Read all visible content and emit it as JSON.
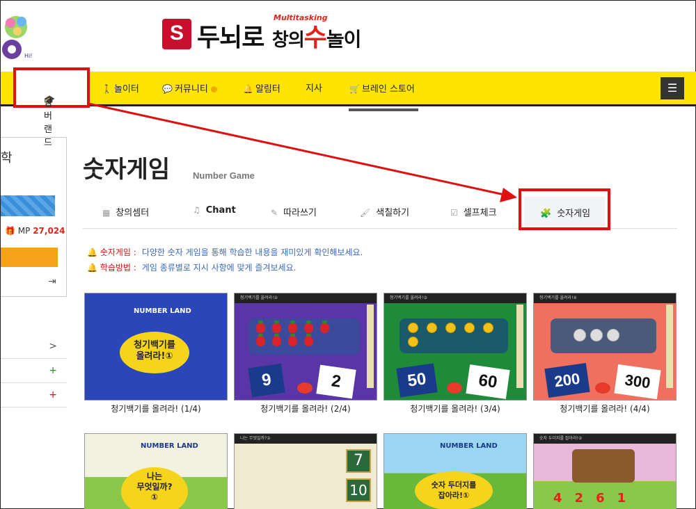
{
  "header": {
    "brand_badge": "S",
    "brand_title_a": "두뇌로 ",
    "brand_title_b": "창의",
    "brand_title_c": "수",
    "brand_title_d": "놀이",
    "brand_sup": "Multitasking"
  },
  "nav": {
    "items": [
      {
        "label": "넘버랜드",
        "icon": "graduation-cap-icon"
      },
      {
        "label": "놀이터",
        "icon": "walk-icon"
      },
      {
        "label": "커뮤니티",
        "icon": "chat-icon"
      },
      {
        "label": "알림터",
        "icon": "bell-icon"
      },
      {
        "label": "지사",
        "icon": ""
      },
      {
        "label": "브레인 스토어",
        "icon": "cart-icon"
      }
    ],
    "menu_icon": "list-menu-icon"
  },
  "sidebar": {
    "partial_text": "학",
    "mp_label": "MP",
    "mp_value": "27,024",
    "rows": [
      ">",
      "+",
      "+"
    ]
  },
  "main": {
    "title": "숫자게임",
    "subtitle": "Number Game",
    "tabs": [
      {
        "label": "창의셈터",
        "icon": "calculator-icon"
      },
      {
        "label": "Chant",
        "icon": "music-icon"
      },
      {
        "label": "따라쓰기",
        "icon": "pencil-icon"
      },
      {
        "label": "색칠하기",
        "icon": "brush-icon"
      },
      {
        "label": "셀프체크",
        "icon": "check-icon"
      },
      {
        "label": "숫자게임",
        "icon": "puzzle-icon",
        "active": true
      }
    ],
    "info": [
      {
        "key": "숫자게임 :",
        "value": "다양한 숫자 게임을 통해 학습한 내용을 재미있게 확인해보세요."
      },
      {
        "key": "학습방법 :",
        "value": "게임 종류별로 지시 사항에 맞게 즐겨보세요."
      }
    ]
  },
  "games": [
    {
      "caption": "청기백기를 올려라! (1/4)",
      "thumb_text": "청기백기를\n올려라!①",
      "logo": "NUMBER LAND"
    },
    {
      "caption": "청기백기를 올려라! (2/4)",
      "flag_left": "9",
      "flag_right": "2"
    },
    {
      "caption": "청기백기를 올려라! (3/4)",
      "flag_left": "50",
      "flag_right": "60"
    },
    {
      "caption": "청기백기를 올려라! (4/4)",
      "flag_left": "200",
      "flag_right": "300"
    },
    {
      "caption": "",
      "thumb_text": "나는\n무엇일까?\n①",
      "logo": "NUMBER LAND"
    },
    {
      "caption": "",
      "num_a": "7",
      "num_b": "10"
    },
    {
      "caption": "",
      "thumb_text": "숫자 두더지를\n잡아라!①",
      "logo": "NUMBER LAND"
    },
    {
      "caption": "",
      "digits": [
        "4",
        "2",
        "6",
        "1"
      ]
    }
  ],
  "colors": {
    "nav_bg": "#ffe400",
    "highlight": "#e01010",
    "accent_red": "#e2231a",
    "info_blue": "#3a6ab8"
  }
}
